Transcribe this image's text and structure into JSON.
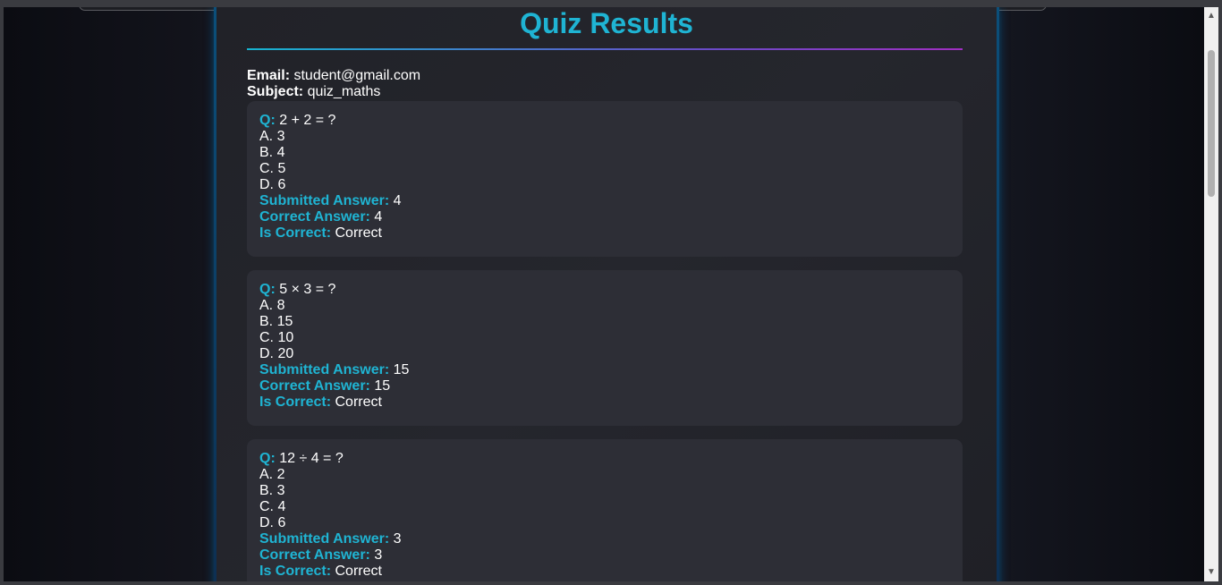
{
  "page": {
    "title": "Quiz Results",
    "email_label": "Email:",
    "email_value": "student@gmail.com",
    "subject_label": "Subject:",
    "subject_value": "quiz_maths"
  },
  "labels": {
    "question": "Q:",
    "submitted": "Submitted Answer:",
    "correct": "Correct Answer:",
    "is_correct": "Is Correct:"
  },
  "questions": [
    {
      "text": "2 + 2 = ?",
      "options": [
        "A. 3",
        "B. 4",
        "C. 5",
        "D. 6"
      ],
      "submitted": "4",
      "correct": "4",
      "is_correct": "Correct"
    },
    {
      "text": "5 × 3 = ?",
      "options": [
        "A. 8",
        "B. 15",
        "C. 10",
        "D. 20"
      ],
      "submitted": "15",
      "correct": "15",
      "is_correct": "Correct"
    },
    {
      "text": "12 ÷ 4 = ?",
      "options": [
        "A. 2",
        "B. 3",
        "C. 4",
        "D. 6"
      ],
      "submitted": "3",
      "correct": "3",
      "is_correct": "Correct"
    }
  ],
  "colors": {
    "accent": "#1fb4d3",
    "card_bg": "#2d2e36",
    "panel_bg": "#23242b"
  },
  "icons": {
    "scroll_up": "triangle-up-icon",
    "scroll_down": "triangle-down-icon"
  }
}
